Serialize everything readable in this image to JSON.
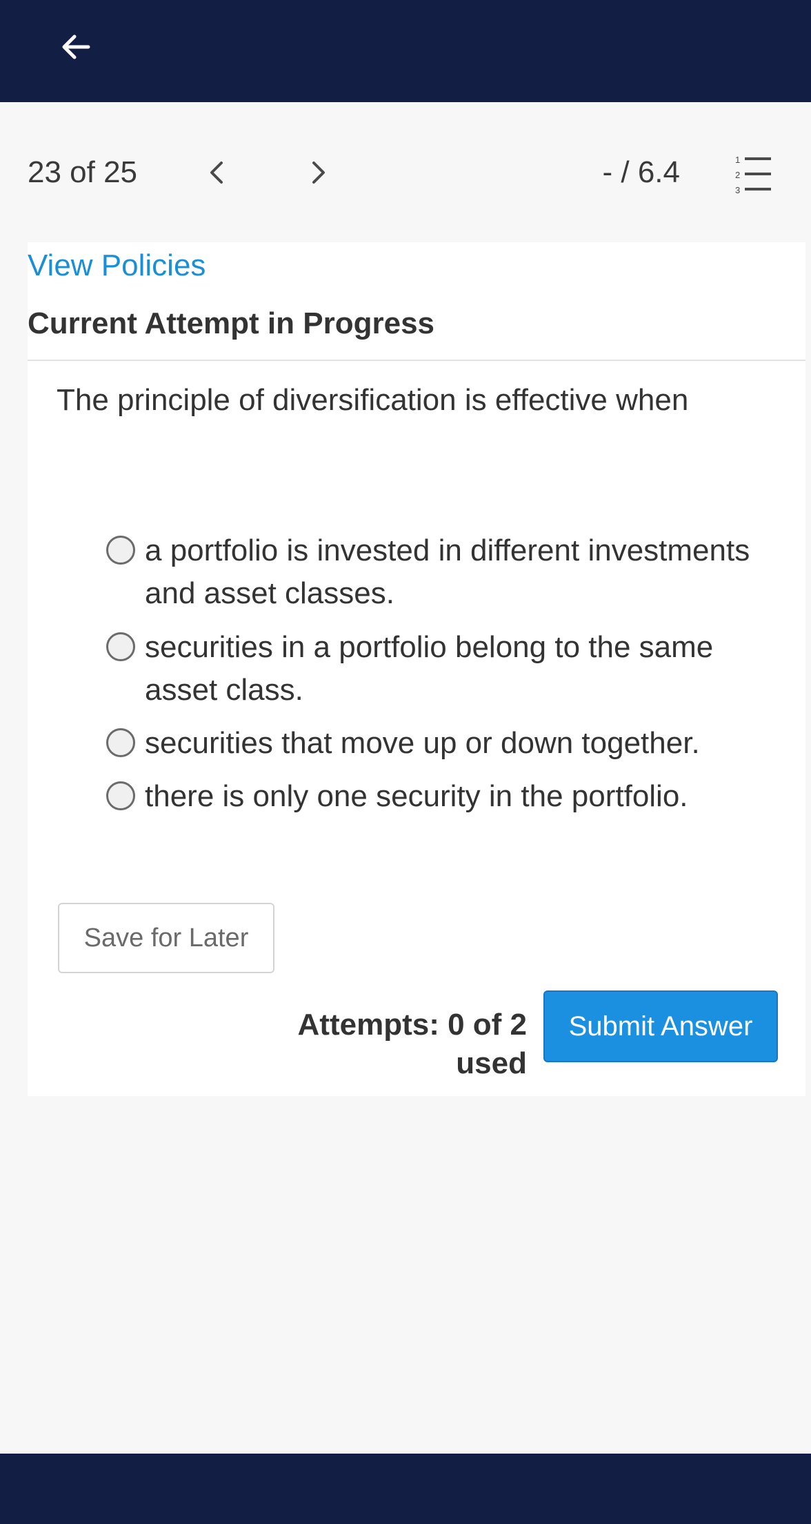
{
  "header": {
    "back_icon": "arrow-left-icon"
  },
  "navigation": {
    "counter": "23 of 25",
    "prev_icon": "chevron-left-icon",
    "next_icon": "chevron-right-icon",
    "score": "- / 6.4",
    "question_list_icon": "numbered-list-icon"
  },
  "card": {
    "policies_link": "View Policies",
    "attempt_title": "Current Attempt in Progress",
    "question": "The principle of diversification is effective when",
    "options": [
      {
        "label": "a portfolio is invested in different investments and asset classes."
      },
      {
        "label": "securities in a portfolio belong to the same asset class."
      },
      {
        "label": "securities that move up or down together."
      },
      {
        "label": "there is only one security in the portfolio."
      }
    ],
    "save_label": "Save for Later",
    "attempts_text": "Attempts: 0 of 2 used",
    "submit_label": "Submit Answer"
  },
  "colors": {
    "header_bg": "#131e44",
    "link": "#1b8fd6",
    "submit_bg": "#1b8fe0"
  }
}
